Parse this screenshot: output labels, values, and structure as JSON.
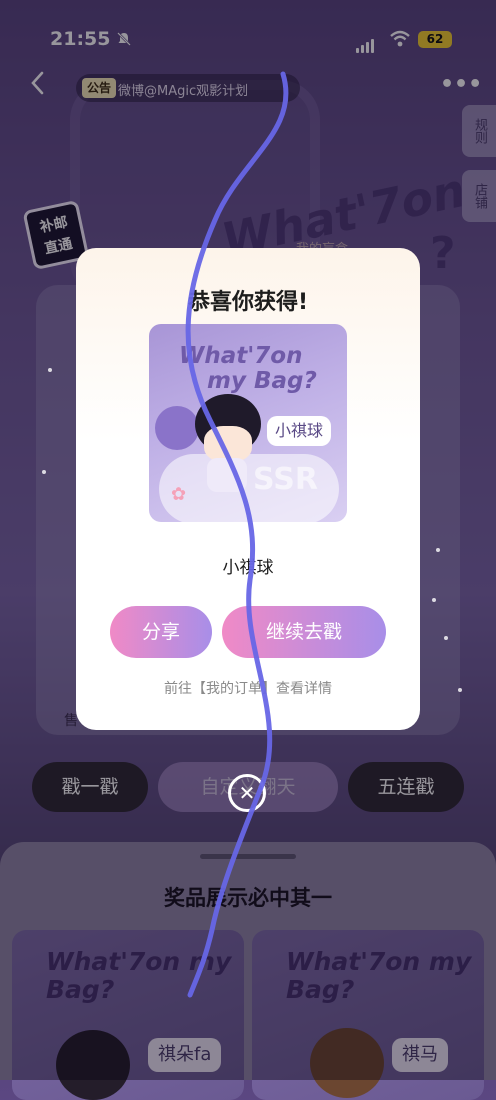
{
  "status_bar": {
    "time": "21:55",
    "battery": "62"
  },
  "nav": {
    "notice_tag": "公告",
    "notice_text": "微博@MAgic观影计划"
  },
  "banner": {
    "title": "What'7on",
    "question_mark": "?",
    "side_rules": "规则",
    "side_store": "店铺",
    "stamp_text": "补邮\n直通",
    "my_box": "我的盲盒"
  },
  "sale_text": "售",
  "actions": {
    "poke_one": "戳一戳",
    "custom": "自定义翻天",
    "poke_five": "五连戳"
  },
  "prizes": {
    "title": "奖品展示必中其一",
    "cards": [
      {
        "title": "What'7on my Bag?",
        "tag": "祺朵fa"
      },
      {
        "title": "What'7on my Bag?",
        "tag": "祺马"
      }
    ]
  },
  "modal": {
    "title": "恭喜你获得!",
    "image": {
      "title_line1": "What'7on",
      "title_line2": "my Bag?",
      "name_tag": "小祺球",
      "rarity": "SSR"
    },
    "prize_name": "小祺球",
    "share_label": "分享",
    "continue_label": "继续去戳",
    "order_hint": "前往【我的订单】查看详情"
  },
  "colors": {
    "accent_pink": "#f08ac6",
    "accent_purple": "#a88ee8",
    "stroke": "#6766e6"
  }
}
